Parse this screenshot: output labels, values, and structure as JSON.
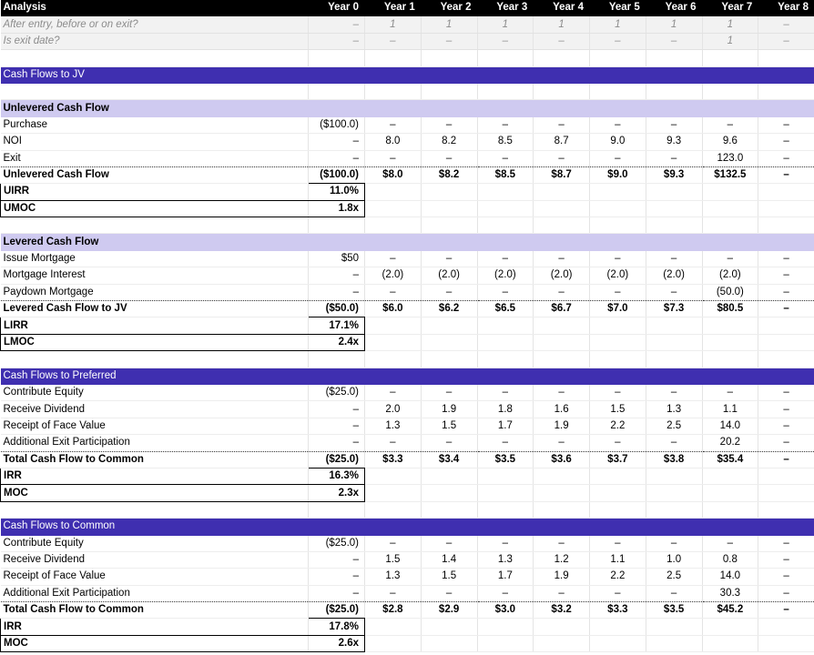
{
  "header": {
    "title": "Analysis",
    "years": [
      "Year 0",
      "Year 1",
      "Year 2",
      "Year 3",
      "Year 4",
      "Year 5",
      "Year 6",
      "Year 7",
      "Year 8"
    ]
  },
  "flags": [
    {
      "label": "After entry, before or on exit?",
      "values": [
        "–",
        "1",
        "1",
        "1",
        "1",
        "1",
        "1",
        "1",
        "–"
      ]
    },
    {
      "label": "Is exit date?",
      "values": [
        "–",
        "–",
        "–",
        "–",
        "–",
        "–",
        "–",
        "1",
        "–"
      ]
    }
  ],
  "jv": {
    "title": "Cash Flows to JV",
    "unlevered": {
      "title": "Unlevered Cash Flow",
      "rows": [
        {
          "label": "Purchase",
          "values": [
            "($100.0)",
            "–",
            "–",
            "–",
            "–",
            "–",
            "–",
            "–",
            "–"
          ]
        },
        {
          "label": "NOI",
          "values": [
            "–",
            "8.0",
            "8.2",
            "8.5",
            "8.7",
            "9.0",
            "9.3",
            "9.6",
            "–"
          ]
        },
        {
          "label": "Exit",
          "values": [
            "–",
            "–",
            "–",
            "–",
            "–",
            "–",
            "–",
            "123.0",
            "–"
          ]
        }
      ],
      "total": {
        "label": "Unlevered Cash Flow",
        "values": [
          "($100.0)",
          "$8.0",
          "$8.2",
          "$8.5",
          "$8.7",
          "$9.0",
          "$9.3",
          "$132.5",
          "–"
        ]
      },
      "metrics": [
        {
          "label": "UIRR",
          "value": "11.0%"
        },
        {
          "label": "UMOC",
          "value": "1.8x"
        }
      ]
    },
    "levered": {
      "title": "Levered Cash Flow",
      "rows": [
        {
          "label": "Issue Mortgage",
          "values": [
            "$50",
            "–",
            "–",
            "–",
            "–",
            "–",
            "–",
            "–",
            "–"
          ]
        },
        {
          "label": "Mortgage Interest",
          "values": [
            "–",
            "(2.0)",
            "(2.0)",
            "(2.0)",
            "(2.0)",
            "(2.0)",
            "(2.0)",
            "(2.0)",
            "–"
          ]
        },
        {
          "label": "Paydown Mortgage",
          "values": [
            "–",
            "–",
            "–",
            "–",
            "–",
            "–",
            "–",
            "(50.0)",
            "–"
          ]
        }
      ],
      "total": {
        "label": "Levered Cash Flow to JV",
        "values": [
          "($50.0)",
          "$6.0",
          "$6.2",
          "$6.5",
          "$6.7",
          "$7.0",
          "$7.3",
          "$80.5",
          "–"
        ]
      },
      "metrics": [
        {
          "label": "LIRR",
          "value": "17.1%"
        },
        {
          "label": "LMOC",
          "value": "2.4x"
        }
      ]
    }
  },
  "preferred": {
    "title": "Cash Flows to Preferred",
    "rows": [
      {
        "label": "Contribute Equity",
        "values": [
          "($25.0)",
          "–",
          "–",
          "–",
          "–",
          "–",
          "–",
          "–",
          "–"
        ]
      },
      {
        "label": "Receive Dividend",
        "values": [
          "–",
          "2.0",
          "1.9",
          "1.8",
          "1.6",
          "1.5",
          "1.3",
          "1.1",
          "–"
        ]
      },
      {
        "label": "Receipt of Face Value",
        "values": [
          "–",
          "1.3",
          "1.5",
          "1.7",
          "1.9",
          "2.2",
          "2.5",
          "14.0",
          "–"
        ]
      },
      {
        "label": "Additional Exit Participation",
        "values": [
          "–",
          "–",
          "–",
          "–",
          "–",
          "–",
          "–",
          "20.2",
          "–"
        ]
      }
    ],
    "total": {
      "label": "Total Cash Flow to Common",
      "values": [
        "($25.0)",
        "$3.3",
        "$3.4",
        "$3.5",
        "$3.6",
        "$3.7",
        "$3.8",
        "$35.4",
        "–"
      ]
    },
    "metrics": [
      {
        "label": "IRR",
        "value": "16.3%"
      },
      {
        "label": "MOC",
        "value": "2.3x"
      }
    ]
  },
  "common": {
    "title": "Cash Flows to Common",
    "rows": [
      {
        "label": "Contribute Equity",
        "values": [
          "($25.0)",
          "–",
          "–",
          "–",
          "–",
          "–",
          "–",
          "–",
          "–"
        ]
      },
      {
        "label": "Receive Dividend",
        "values": [
          "–",
          "1.5",
          "1.4",
          "1.3",
          "1.2",
          "1.1",
          "1.0",
          "0.8",
          "–"
        ]
      },
      {
        "label": "Receipt of Face Value",
        "values": [
          "–",
          "1.3",
          "1.5",
          "1.7",
          "1.9",
          "2.2",
          "2.5",
          "14.0",
          "–"
        ]
      },
      {
        "label": "Additional Exit Participation",
        "values": [
          "–",
          "–",
          "–",
          "–",
          "–",
          "–",
          "–",
          "30.3",
          "–"
        ]
      }
    ],
    "total": {
      "label": "Total Cash Flow to Common",
      "values": [
        "($25.0)",
        "$2.8",
        "$2.9",
        "$3.0",
        "$3.2",
        "$3.3",
        "$3.5",
        "$45.2",
        "–"
      ]
    },
    "metrics": [
      {
        "label": "IRR",
        "value": "17.8%"
      },
      {
        "label": "MOC",
        "value": "2.6x"
      }
    ]
  },
  "colors": {
    "header_bg": "#000000",
    "section_bg": "#3f2fb0",
    "subsection_bg": "#cfcaf0",
    "flag_text": "#8c8c8c"
  }
}
